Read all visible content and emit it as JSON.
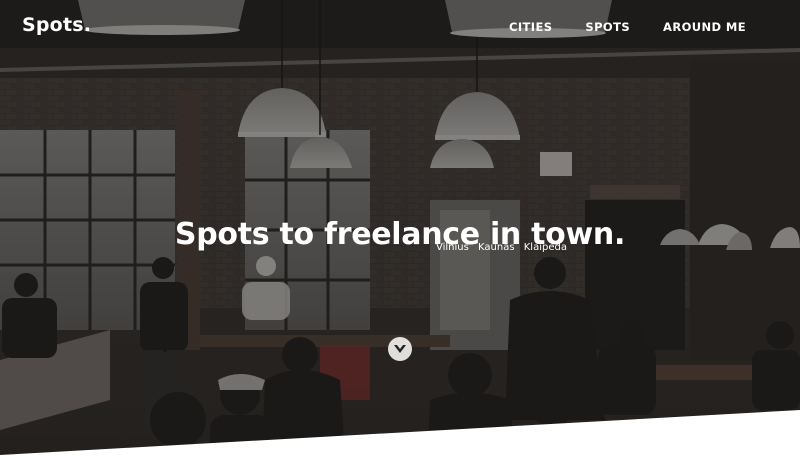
{
  "brand": {
    "name": "Spots."
  },
  "nav": {
    "items": [
      "CITIES",
      "SPOTS",
      "AROUND ME"
    ]
  },
  "hero": {
    "title": "Spots to freelance in town.",
    "cities": [
      "Vilnius",
      "Kaunas",
      "Klaipeda"
    ],
    "scroll_icon": "chevron-down-circle-icon"
  },
  "colors": {
    "overlay": "#1c1a19",
    "text": "#ffffff",
    "page_bg": "#ffffff"
  }
}
